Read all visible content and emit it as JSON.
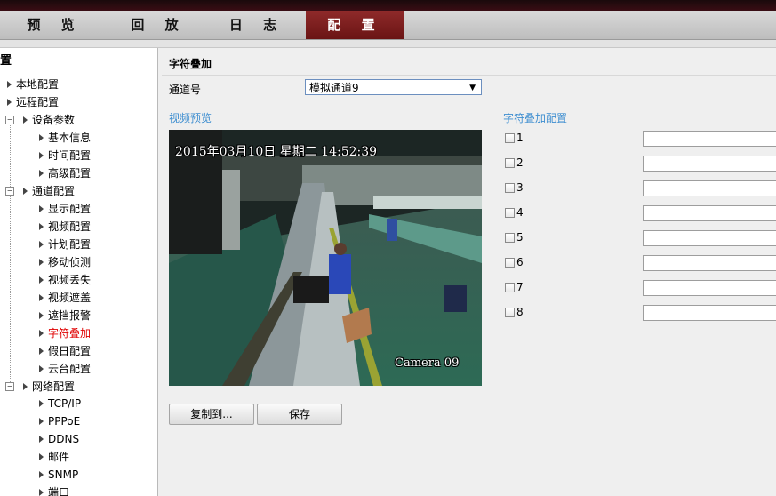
{
  "nav": {
    "tabs": [
      {
        "label": "预 览"
      },
      {
        "label": "回 放"
      },
      {
        "label": "日 志"
      },
      {
        "label": "配 置",
        "active": true
      }
    ]
  },
  "sidebar": {
    "root_label": "置",
    "items": [
      {
        "label": "本地配置"
      },
      {
        "label": "远程配置"
      },
      {
        "label": "设备参数"
      },
      {
        "label": "基本信息"
      },
      {
        "label": "时间配置"
      },
      {
        "label": "高级配置"
      },
      {
        "label": "通道配置"
      },
      {
        "label": "显示配置"
      },
      {
        "label": "视频配置"
      },
      {
        "label": "计划配置"
      },
      {
        "label": "移动侦测"
      },
      {
        "label": "视频丢失"
      },
      {
        "label": "视频遮盖"
      },
      {
        "label": "遮挡报警"
      },
      {
        "label": "字符叠加",
        "active": true
      },
      {
        "label": "假日配置"
      },
      {
        "label": "云台配置"
      },
      {
        "label": "网络配置"
      },
      {
        "label": "TCP/IP"
      },
      {
        "label": "PPPoE"
      },
      {
        "label": "DDNS"
      },
      {
        "label": "邮件"
      },
      {
        "label": "SNMP"
      },
      {
        "label": "端口"
      }
    ]
  },
  "main": {
    "title": "字符叠加",
    "channel_label": "通道号",
    "channel_value": "模拟通道9",
    "preview_label": "视频预览",
    "osd_datetime": "2015年03月10日  星期二  14:52:39",
    "osd_camera": "Camera 09",
    "copy_button": "复制到...",
    "save_button": "保存",
    "overlay_title": "字符叠加配置",
    "overlay_rows": [
      "1",
      "2",
      "3",
      "4",
      "5",
      "6",
      "7",
      "8"
    ]
  },
  "colors": {
    "active_tab": "#7a1e1e",
    "active_item": "#e00000",
    "section_label": "#3e8ed0"
  }
}
